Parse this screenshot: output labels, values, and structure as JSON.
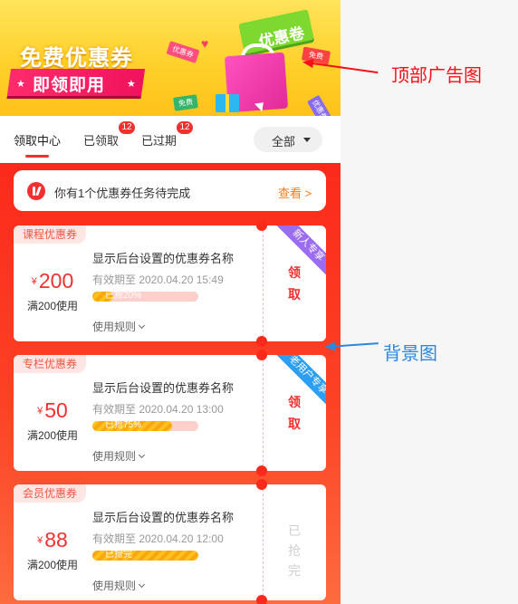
{
  "banner": {
    "title": "免费优惠券",
    "subtitle": "即领即用",
    "tag": "优惠卷",
    "mini_coupons": [
      "优惠券",
      "免费",
      "免费",
      "优惠券"
    ],
    "colors": {
      "background": "#ffd233",
      "ribbon": "#f0135d",
      "tag": "#7dd82f",
      "bag": "#ff52c0"
    }
  },
  "tabs": {
    "items": [
      {
        "label": "领取中心",
        "active": true
      },
      {
        "label": "已领取",
        "badge": "12"
      },
      {
        "label": "已过期",
        "badge": "12"
      }
    ],
    "filter": "全部"
  },
  "task": {
    "text": "你有1个优惠券任务待完成",
    "link": "查看 >"
  },
  "coupons": [
    {
      "category": "课程优惠券",
      "currency": "¥",
      "amount": "200",
      "min": "满200使用",
      "name": "显示后台设置的优惠券名称",
      "expiry": "有效期至 2020.04.20 15:49",
      "progress_text": "已抢20%",
      "progress": 0.2,
      "rule": "使用规则",
      "action": "领取",
      "corner": "新人专享",
      "corner_color": "#9b6cf2"
    },
    {
      "category": "专栏优惠券",
      "currency": "¥",
      "amount": "50",
      "min": "满200使用",
      "name": "显示后台设置的优惠券名称",
      "expiry": "有效期至 2020.04.20 13:00",
      "progress_text": "已抢75%",
      "progress": 0.75,
      "rule": "使用规则",
      "action": "领取",
      "corner": "老用户专享",
      "corner_color": "#2b9ef5"
    },
    {
      "category": "会员优惠券",
      "currency": "¥",
      "amount": "88",
      "min": "满200使用",
      "name": "显示后台设置的优惠券名称",
      "expiry": "有效期至 2020.04.20 12:00",
      "progress_text": "已抢完",
      "progress": 1.0,
      "rule": "使用规则",
      "action": "已抢完"
    }
  ],
  "annotations": {
    "top": "顶部广告图",
    "background": "背景图"
  }
}
